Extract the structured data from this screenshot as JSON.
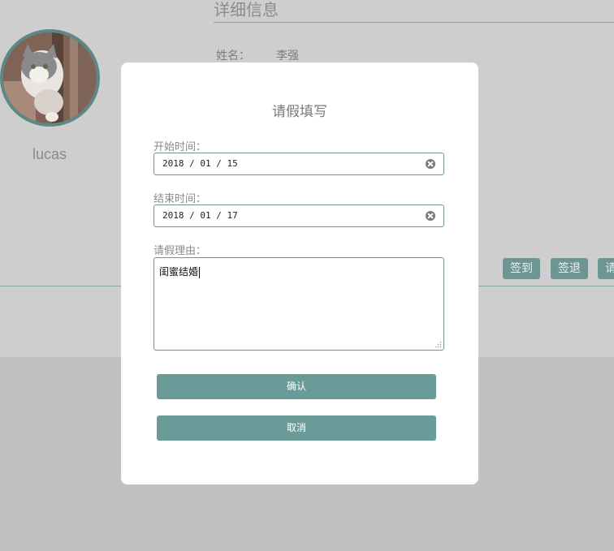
{
  "profile": {
    "username": "lucas"
  },
  "detail": {
    "title": "详细信息",
    "name_label": "姓名：",
    "name_value": "李强"
  },
  "actions": {
    "sign_in": "签到",
    "sign_out": "签退",
    "leave_partial": "请"
  },
  "modal": {
    "title": "请假填写",
    "start_label": "开始时间：",
    "start_value": "2018 / 01 / 15",
    "end_label": "结束时间：",
    "end_value": "2018 / 01 / 17",
    "reason_label": "请假理由：",
    "reason_value": "闺蜜结婚",
    "confirm": "确认",
    "cancel": "取消"
  },
  "colors": {
    "accent": "#6b9b99",
    "overlay": "#cecece",
    "modal_bg": "#ffffff"
  },
  "icons": {
    "clear": "clear-icon",
    "resize": "resize-grip-icon"
  }
}
